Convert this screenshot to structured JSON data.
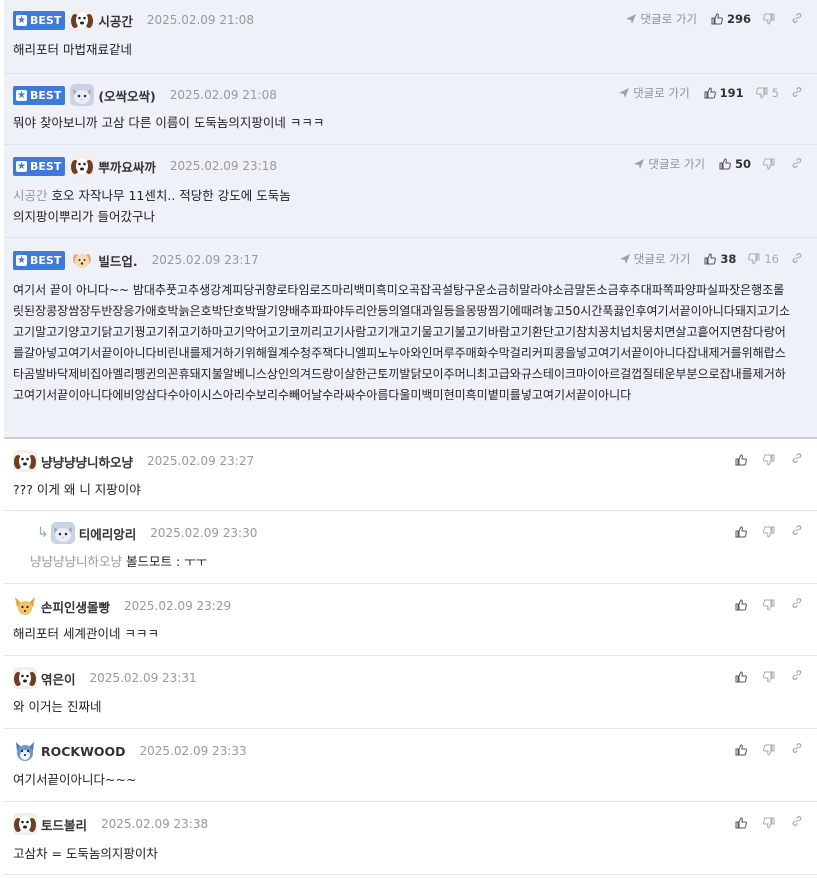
{
  "labels": {
    "best": "BEST",
    "reply_link": "댓글로 가기"
  },
  "comments": [
    {
      "best": true,
      "avatar": "beagle-avatar",
      "nick": "시공간",
      "date": "2025.02.09 21:08",
      "up": "296",
      "down": "",
      "to": "",
      "text": "해리포터 마법재료같네"
    },
    {
      "best": true,
      "avatar": "cat-avatar",
      "nick": "(오싹오싹)",
      "date": "2025.02.09 21:08",
      "up": "191",
      "down": "5",
      "to": "",
      "text": "뭐야 찾아보니까 고삼 다른 이름이 도둑놈의지팡이네 ㅋㅋㅋ"
    },
    {
      "best": true,
      "avatar": "beagle-avatar",
      "nick": "뿌까요싸까",
      "date": "2025.02.09 23:18",
      "up": "50",
      "down": "",
      "to": "시공간",
      "text": "호오 자작나무 11센치.. 적당한 강도에 도둑놈의지팡이뿌리가 들어갔구나"
    },
    {
      "best": true,
      "avatar": "puppy-avatar",
      "nick": "빌드업.",
      "date": "2025.02.09 23:17",
      "up": "38",
      "down": "16",
      "to": "",
      "text": "여기서 끝이 아니다~~ 밤대추풋고추생강계피당귀향로타임로즈마리백미흑미오곡잡곡설탕구운소금히말라야소금말돈소금후추대파쪽파양파실파잣은행조롤릿된장콩장쌈장두반장응가애호박늙은호박단호박딸기양배추파파야두리안등의열대과일등을몽땅찜기에때려놓고50시간푹끓인후여기서끝이아니다돼지고기소고기말고기양고기닭고기꿩고기쥐고기하마고기악어고기코끼리고기사람고기개고기물고기불고기바람고기환단고기참치꽁치넙치뭉치면살고흩어지면참다랑어를갈아넣고여기서끝이아니다비린내를제거하기위해월계수청주잭다니엘피노누아와인머루주매화수막걸리커피콩을넣고여기서끝이아니다잡내제거를위해랍스타곰발바닥제비집아멜리펭귄의꼰휴돼지불알베니스상인의겨드랑이살한근토끼발닭모이주머니최고급와규스테이크마이아르걸껍질테운부분으로잡내를제거하고여기서끝이아니다에비앙삼다수아이시스아리수보리수빼어날수라싸수아름다울미백미현미흑미볕미를넣고여기서끝이아니다"
    },
    {
      "best": false,
      "reply": false,
      "avatar": "beagle-avatar",
      "nick": "냥냥냥냥니하오냥",
      "date": "2025.02.09 23:27",
      "to": "",
      "text": "??? 이게 왜 니 지팡이야"
    },
    {
      "best": false,
      "reply": true,
      "avatar": "cat-avatar",
      "nick": "티에리앙리",
      "date": "2025.02.09 23:30",
      "to": "냥냥냥냥니하오냥",
      "text": "볼드모트 : ㅜㅜ"
    },
    {
      "best": false,
      "reply": false,
      "avatar": "fox-avatar",
      "nick": "손피인생몰빵",
      "date": "2025.02.09 23:29",
      "to": "",
      "text": "해리포터 세계관이네 ㅋㅋㅋ"
    },
    {
      "best": false,
      "reply": false,
      "avatar": "beagle-avatar",
      "nick": "엮은이",
      "date": "2025.02.09 23:31",
      "to": "",
      "text": "와 이거는 진짜네"
    },
    {
      "best": false,
      "reply": false,
      "avatar": "husky-avatar",
      "nick": "ROCKWOOD",
      "date": "2025.02.09 23:33",
      "to": "",
      "text": "여기서끝이아니다~~~"
    },
    {
      "best": false,
      "reply": false,
      "avatar": "beagle-avatar",
      "nick": "토드볼리",
      "date": "2025.02.09 23:38",
      "to": "",
      "text": "고삼차 = 도둑놈의지팡이차"
    }
  ]
}
